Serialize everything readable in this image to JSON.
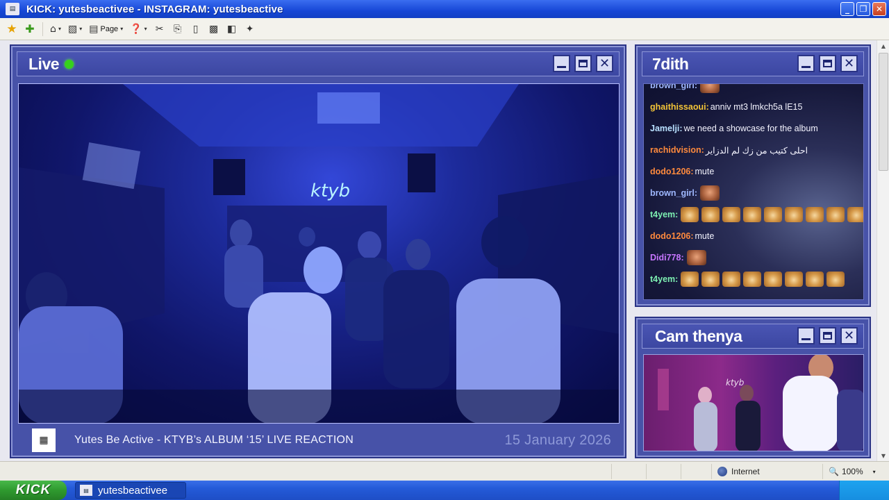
{
  "window": {
    "title": "KICK: yutesbeactivee -  INSTAGRAM: yutesbeactive",
    "app_icon_glyph": "▤",
    "min_glyph": "_",
    "max_glyph": "❐",
    "close_glyph": "✕"
  },
  "toolbar": {
    "page_label": "Page",
    "dropdown_glyph": "▾",
    "icons": [
      "favorites-star-icon",
      "add-favorite-icon",
      "home-icon",
      "feeds-icon",
      "page-icon",
      "help-icon",
      "tools-icon",
      "copy-icon",
      "print-icon",
      "research-icon",
      "fullscreen-icon",
      "messenger-icon"
    ]
  },
  "main_panel": {
    "title": "Live",
    "live_indicator_color": "#36d11c",
    "qr_glyph": "▦",
    "stream_title": "Yutes Be Active - KTYB’s ALBUM ‘15’ LIVE REACTION",
    "date": "15 January 2026",
    "neon_sign": "ktyb"
  },
  "chat_panel": {
    "title": "7dith",
    "messages": [
      {
        "user": "brown_girl:",
        "text": "",
        "color": "#9fb8ff",
        "emotes": 1,
        "emote_type": "face"
      },
      {
        "user": "ghaithissaoui:",
        "text": "anniv mt3 lmkch5a lE15",
        "color": "#f3c437",
        "emotes": 0,
        "emote_type": ""
      },
      {
        "user": "Jamelji:",
        "text": "we need a showcase for the album",
        "color": "#b8e0ff",
        "emotes": 0,
        "emote_type": ""
      },
      {
        "user": "rachidvision:",
        "text": "احلى كتيب من زك لم الدزاير",
        "color": "#ff8a3d",
        "emotes": 0,
        "emote_type": ""
      },
      {
        "user": "dodo1206:",
        "text": "mute",
        "color": "#ff8a3d",
        "emotes": 0,
        "emote_type": ""
      },
      {
        "user": "brown_girl:",
        "text": "",
        "color": "#9fb8ff",
        "emotes": 1,
        "emote_type": "face"
      },
      {
        "user": "t4yem:",
        "text": "",
        "color": "#7df0b2",
        "emotes": 9,
        "emote_type": "cat"
      },
      {
        "user": "dodo1206:",
        "text": "mute",
        "color": "#ff8a3d",
        "emotes": 0,
        "emote_type": ""
      },
      {
        "user": "Didi778:",
        "text": "",
        "color": "#c776ff",
        "emotes": 1,
        "emote_type": "face"
      },
      {
        "user": "t4yem:",
        "text": "",
        "color": "#7df0b2",
        "emotes": 8,
        "emote_type": "cat"
      }
    ]
  },
  "cam_panel": {
    "title": "Cam thenya"
  },
  "statusbar": {
    "zone": "Internet",
    "zoom": "100%",
    "zoom_glyph": "🔍"
  },
  "taskbar": {
    "start_label": "KICK",
    "task_label": "yutesbeactivee",
    "task_icon_glyph": "▤"
  },
  "scrollbar": {
    "up_glyph": "▲",
    "down_glyph": "▼"
  },
  "colors": {
    "panel": "#4752a8",
    "panel_border": "#2a3385",
    "title_bar": "#1747d6"
  }
}
